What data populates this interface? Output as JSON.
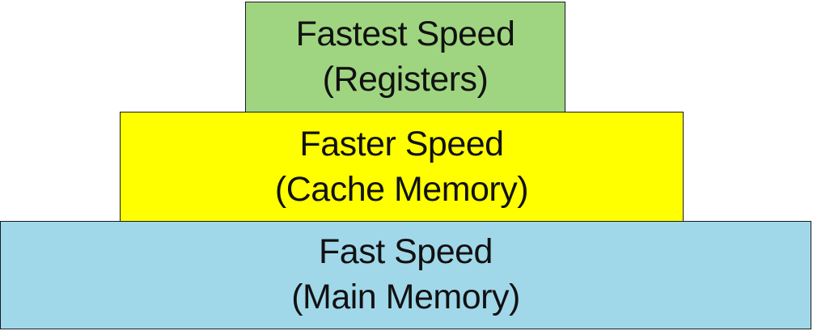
{
  "diagram": {
    "type": "memory-hierarchy-pyramid",
    "tiers": [
      {
        "line1": "Fastest Speed",
        "line2": "(Registers)",
        "color": "#9fd580"
      },
      {
        "line1": "Faster Speed",
        "line2": "(Cache Memory)",
        "color": "#ffff00"
      },
      {
        "line1": "Fast Speed",
        "line2": "(Main Memory)",
        "color": "#a0d8ea"
      }
    ]
  }
}
